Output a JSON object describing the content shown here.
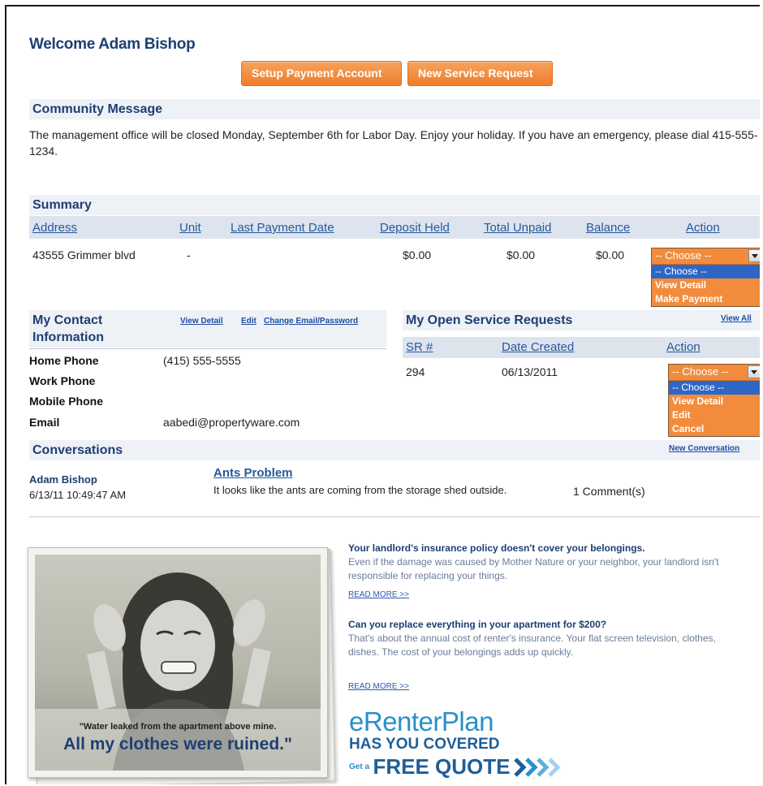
{
  "welcome": "Welcome Adam Bishop",
  "buttons": {
    "setup_payment": "Setup Payment Account",
    "new_service_request": "New Service Request"
  },
  "community": {
    "title": "Community Message",
    "message": "The management office will be closed Monday, September 6th for Labor Day.  Enjoy your holiday.  If you have an emergency, please dial 415-555-1234."
  },
  "summary": {
    "title": "Summary",
    "headers": {
      "address": "Address",
      "unit": "Unit",
      "last_payment": "Last Payment Date",
      "deposit": "Deposit Held",
      "unpaid": "Total Unpaid",
      "balance": "Balance",
      "action": "Action"
    },
    "row": {
      "address": "43555 Grimmer blvd",
      "unit": "-",
      "last_payment": "",
      "deposit": "$0.00",
      "unpaid": "$0.00",
      "balance": "$0.00"
    },
    "dropdown": {
      "selected": "-- Choose --",
      "options": [
        "-- Choose --",
        "View Detail",
        "Make Payment"
      ]
    }
  },
  "contact": {
    "title": "My Contact Information",
    "links": {
      "view_detail": "View Detail",
      "edit": "Edit",
      "change_email": "Change Email/Password"
    },
    "fields": {
      "home_phone_label": "Home Phone",
      "home_phone": "(415) 555-5555",
      "work_phone_label": "Work Phone",
      "work_phone": "",
      "mobile_phone_label": "Mobile Phone",
      "mobile_phone": "",
      "email_label": "Email",
      "email": "aabedi@propertyware.com"
    }
  },
  "service_requests": {
    "title": "My Open Service Requests",
    "view_all": "View All",
    "headers": {
      "sr": "SR #",
      "date": "Date Created",
      "action": "Action"
    },
    "row": {
      "sr": "294",
      "date": "06/13/2011"
    },
    "dropdown": {
      "selected": "-- Choose --",
      "options": [
        "-- Choose --",
        "View Detail",
        "Edit",
        "Cancel"
      ]
    }
  },
  "conversations": {
    "title": "Conversations",
    "new_link": "New Conversation",
    "item": {
      "author": "Adam Bishop",
      "timestamp": "6/13/11 10:49:47 AM",
      "subject": "Ants Problem",
      "body": "It looks like the ants are coming from the storage shed outside.",
      "comments": "1 Comment(s)"
    }
  },
  "ad": {
    "photo_caption_top": "\"Water leaked from the apartment above mine.",
    "photo_caption_big": "All my clothes were ruined.\"",
    "block1_head": "Your landlord's insurance policy doesn't cover your belongings.",
    "block1_body": "Even if the damage was caused by Mother Nature or your neighbor, your landlord isn't responsible for replacing your things.",
    "block1_link": "READ MORE >>",
    "block2_head": "Can you replace everything in your apartment for $200?",
    "block2_body": "That's about the annual cost of renter's insurance. Your flat screen television, clothes, dishes. The cost of your belongings adds up quickly.",
    "block2_link": "READ MORE >>",
    "brand": "eRenterPlan",
    "tagline": "HAS YOU COVERED",
    "cta_prefix": "Get a",
    "cta": "FREE QUOTE",
    "accent": "#2a8fc9"
  },
  "colors": {
    "orange": "#ef7d2b",
    "navy": "#1d3f73",
    "link": "#27589b",
    "section_bg": "#eef1f6",
    "dropdown_selected": "#2f66c6"
  }
}
